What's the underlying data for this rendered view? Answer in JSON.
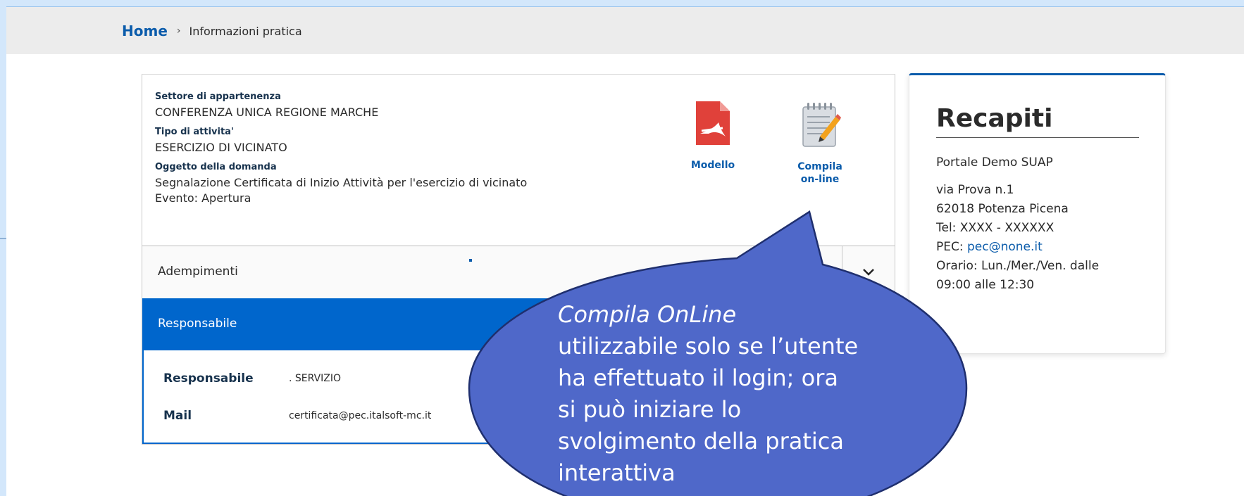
{
  "breadcrumb": {
    "home": "Home",
    "separator": "›",
    "current": "Informazioni pratica"
  },
  "practice": {
    "settore_label": "Settore di appartenenza",
    "settore_value": "CONFERENZA UNICA REGIONE MARCHE",
    "tipo_label": "Tipo di attivita'",
    "tipo_value": "ESERCIZIO DI VICINATO",
    "oggetto_label": "Oggetto della domanda",
    "oggetto_value": "Segnalazione Certificata di Inizio Attività per l'esercizio di vicinato",
    "evento_value": "Evento: Apertura"
  },
  "actions": {
    "modello_label": "Modello",
    "compila_label_1": "Compila",
    "compila_label_2": "on-line",
    "modello_icon": "pdf-document-icon",
    "compila_icon": "notepad-pencil-icon"
  },
  "accordion": {
    "adempimenti_label": "Adempimenti",
    "responsabile_label": "Responsabile"
  },
  "responsabile": {
    "responsabile_key": "Responsabile",
    "responsabile_value": ". SERVIZIO",
    "mail_key": "Mail",
    "mail_value": "certificata@pec.italsoft-mc.it"
  },
  "contacts": {
    "title": "Recapiti",
    "portal": "Portale Demo SUAP",
    "address_1": "via Prova n.1",
    "address_2": "62018 Potenza Picena",
    "tel": "Tel: XXXX - XXXXXX",
    "pec_label": "PEC: ",
    "pec_link": "pec@none.it",
    "orario_1": "Orario: Lun./Mer./Ven. dalle",
    "orario_2": "09:00 alle 12:30"
  },
  "callout": {
    "title": "Compila OnLine",
    "line_1": "utilizzabile solo se l’utente",
    "line_2": "ha effettuato il login; ora",
    "line_3": "si può iniziare lo",
    "line_4": "svolgimento della pratica",
    "line_5": "interattiva"
  },
  "colors": {
    "primary_blue": "#0066cc",
    "link_blue": "#0b5cab",
    "callout_fill": "#4f68c9",
    "callout_stroke": "#1f2f6e",
    "pdf_red": "#e0413a"
  }
}
